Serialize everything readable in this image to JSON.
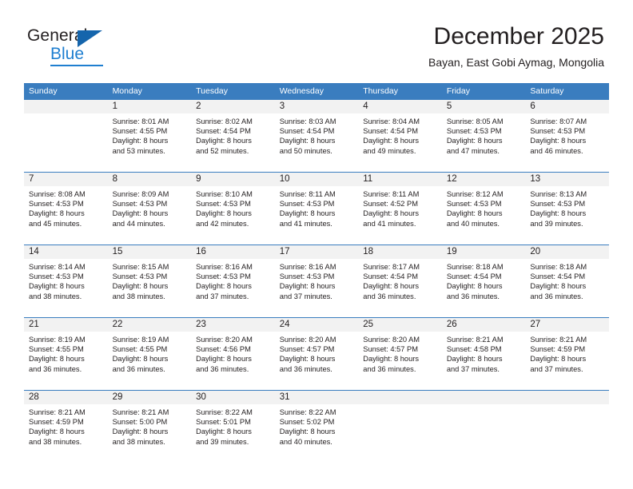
{
  "brand": {
    "name_part1": "General",
    "name_part2": "Blue",
    "triangle_color": "#1565ac",
    "blue_color": "#1f7fd0"
  },
  "header": {
    "title": "December 2025",
    "location": "Bayan, East Gobi Aymag, Mongolia"
  },
  "theme": {
    "header_row_bg": "#3a7dbf",
    "daynum_band_bg": "#f2f2f2",
    "separator": "#3a7dbf",
    "text": "#231f20"
  },
  "weekday_headers": [
    "Sunday",
    "Monday",
    "Tuesday",
    "Wednesday",
    "Thursday",
    "Friday",
    "Saturday"
  ],
  "weeks": [
    [
      {
        "day": "",
        "sunrise": "",
        "sunset": "",
        "daylight_line1": "",
        "daylight_line2": ""
      },
      {
        "day": "1",
        "sunrise": "Sunrise: 8:01 AM",
        "sunset": "Sunset: 4:55 PM",
        "daylight_line1": "Daylight: 8 hours",
        "daylight_line2": "and 53 minutes."
      },
      {
        "day": "2",
        "sunrise": "Sunrise: 8:02 AM",
        "sunset": "Sunset: 4:54 PM",
        "daylight_line1": "Daylight: 8 hours",
        "daylight_line2": "and 52 minutes."
      },
      {
        "day": "3",
        "sunrise": "Sunrise: 8:03 AM",
        "sunset": "Sunset: 4:54 PM",
        "daylight_line1": "Daylight: 8 hours",
        "daylight_line2": "and 50 minutes."
      },
      {
        "day": "4",
        "sunrise": "Sunrise: 8:04 AM",
        "sunset": "Sunset: 4:54 PM",
        "daylight_line1": "Daylight: 8 hours",
        "daylight_line2": "and 49 minutes."
      },
      {
        "day": "5",
        "sunrise": "Sunrise: 8:05 AM",
        "sunset": "Sunset: 4:53 PM",
        "daylight_line1": "Daylight: 8 hours",
        "daylight_line2": "and 47 minutes."
      },
      {
        "day": "6",
        "sunrise": "Sunrise: 8:07 AM",
        "sunset": "Sunset: 4:53 PM",
        "daylight_line1": "Daylight: 8 hours",
        "daylight_line2": "and 46 minutes."
      }
    ],
    [
      {
        "day": "7",
        "sunrise": "Sunrise: 8:08 AM",
        "sunset": "Sunset: 4:53 PM",
        "daylight_line1": "Daylight: 8 hours",
        "daylight_line2": "and 45 minutes."
      },
      {
        "day": "8",
        "sunrise": "Sunrise: 8:09 AM",
        "sunset": "Sunset: 4:53 PM",
        "daylight_line1": "Daylight: 8 hours",
        "daylight_line2": "and 44 minutes."
      },
      {
        "day": "9",
        "sunrise": "Sunrise: 8:10 AM",
        "sunset": "Sunset: 4:53 PM",
        "daylight_line1": "Daylight: 8 hours",
        "daylight_line2": "and 42 minutes."
      },
      {
        "day": "10",
        "sunrise": "Sunrise: 8:11 AM",
        "sunset": "Sunset: 4:53 PM",
        "daylight_line1": "Daylight: 8 hours",
        "daylight_line2": "and 41 minutes."
      },
      {
        "day": "11",
        "sunrise": "Sunrise: 8:11 AM",
        "sunset": "Sunset: 4:52 PM",
        "daylight_line1": "Daylight: 8 hours",
        "daylight_line2": "and 41 minutes."
      },
      {
        "day": "12",
        "sunrise": "Sunrise: 8:12 AM",
        "sunset": "Sunset: 4:53 PM",
        "daylight_line1": "Daylight: 8 hours",
        "daylight_line2": "and 40 minutes."
      },
      {
        "day": "13",
        "sunrise": "Sunrise: 8:13 AM",
        "sunset": "Sunset: 4:53 PM",
        "daylight_line1": "Daylight: 8 hours",
        "daylight_line2": "and 39 minutes."
      }
    ],
    [
      {
        "day": "14",
        "sunrise": "Sunrise: 8:14 AM",
        "sunset": "Sunset: 4:53 PM",
        "daylight_line1": "Daylight: 8 hours",
        "daylight_line2": "and 38 minutes."
      },
      {
        "day": "15",
        "sunrise": "Sunrise: 8:15 AM",
        "sunset": "Sunset: 4:53 PM",
        "daylight_line1": "Daylight: 8 hours",
        "daylight_line2": "and 38 minutes."
      },
      {
        "day": "16",
        "sunrise": "Sunrise: 8:16 AM",
        "sunset": "Sunset: 4:53 PM",
        "daylight_line1": "Daylight: 8 hours",
        "daylight_line2": "and 37 minutes."
      },
      {
        "day": "17",
        "sunrise": "Sunrise: 8:16 AM",
        "sunset": "Sunset: 4:53 PM",
        "daylight_line1": "Daylight: 8 hours",
        "daylight_line2": "and 37 minutes."
      },
      {
        "day": "18",
        "sunrise": "Sunrise: 8:17 AM",
        "sunset": "Sunset: 4:54 PM",
        "daylight_line1": "Daylight: 8 hours",
        "daylight_line2": "and 36 minutes."
      },
      {
        "day": "19",
        "sunrise": "Sunrise: 8:18 AM",
        "sunset": "Sunset: 4:54 PM",
        "daylight_line1": "Daylight: 8 hours",
        "daylight_line2": "and 36 minutes."
      },
      {
        "day": "20",
        "sunrise": "Sunrise: 8:18 AM",
        "sunset": "Sunset: 4:54 PM",
        "daylight_line1": "Daylight: 8 hours",
        "daylight_line2": "and 36 minutes."
      }
    ],
    [
      {
        "day": "21",
        "sunrise": "Sunrise: 8:19 AM",
        "sunset": "Sunset: 4:55 PM",
        "daylight_line1": "Daylight: 8 hours",
        "daylight_line2": "and 36 minutes."
      },
      {
        "day": "22",
        "sunrise": "Sunrise: 8:19 AM",
        "sunset": "Sunset: 4:55 PM",
        "daylight_line1": "Daylight: 8 hours",
        "daylight_line2": "and 36 minutes."
      },
      {
        "day": "23",
        "sunrise": "Sunrise: 8:20 AM",
        "sunset": "Sunset: 4:56 PM",
        "daylight_line1": "Daylight: 8 hours",
        "daylight_line2": "and 36 minutes."
      },
      {
        "day": "24",
        "sunrise": "Sunrise: 8:20 AM",
        "sunset": "Sunset: 4:57 PM",
        "daylight_line1": "Daylight: 8 hours",
        "daylight_line2": "and 36 minutes."
      },
      {
        "day": "25",
        "sunrise": "Sunrise: 8:20 AM",
        "sunset": "Sunset: 4:57 PM",
        "daylight_line1": "Daylight: 8 hours",
        "daylight_line2": "and 36 minutes."
      },
      {
        "day": "26",
        "sunrise": "Sunrise: 8:21 AM",
        "sunset": "Sunset: 4:58 PM",
        "daylight_line1": "Daylight: 8 hours",
        "daylight_line2": "and 37 minutes."
      },
      {
        "day": "27",
        "sunrise": "Sunrise: 8:21 AM",
        "sunset": "Sunset: 4:59 PM",
        "daylight_line1": "Daylight: 8 hours",
        "daylight_line2": "and 37 minutes."
      }
    ],
    [
      {
        "day": "28",
        "sunrise": "Sunrise: 8:21 AM",
        "sunset": "Sunset: 4:59 PM",
        "daylight_line1": "Daylight: 8 hours",
        "daylight_line2": "and 38 minutes."
      },
      {
        "day": "29",
        "sunrise": "Sunrise: 8:21 AM",
        "sunset": "Sunset: 5:00 PM",
        "daylight_line1": "Daylight: 8 hours",
        "daylight_line2": "and 38 minutes."
      },
      {
        "day": "30",
        "sunrise": "Sunrise: 8:22 AM",
        "sunset": "Sunset: 5:01 PM",
        "daylight_line1": "Daylight: 8 hours",
        "daylight_line2": "and 39 minutes."
      },
      {
        "day": "31",
        "sunrise": "Sunrise: 8:22 AM",
        "sunset": "Sunset: 5:02 PM",
        "daylight_line1": "Daylight: 8 hours",
        "daylight_line2": "and 40 minutes."
      },
      {
        "day": "",
        "sunrise": "",
        "sunset": "",
        "daylight_line1": "",
        "daylight_line2": ""
      },
      {
        "day": "",
        "sunrise": "",
        "sunset": "",
        "daylight_line1": "",
        "daylight_line2": ""
      },
      {
        "day": "",
        "sunrise": "",
        "sunset": "",
        "daylight_line1": "",
        "daylight_line2": ""
      }
    ]
  ]
}
